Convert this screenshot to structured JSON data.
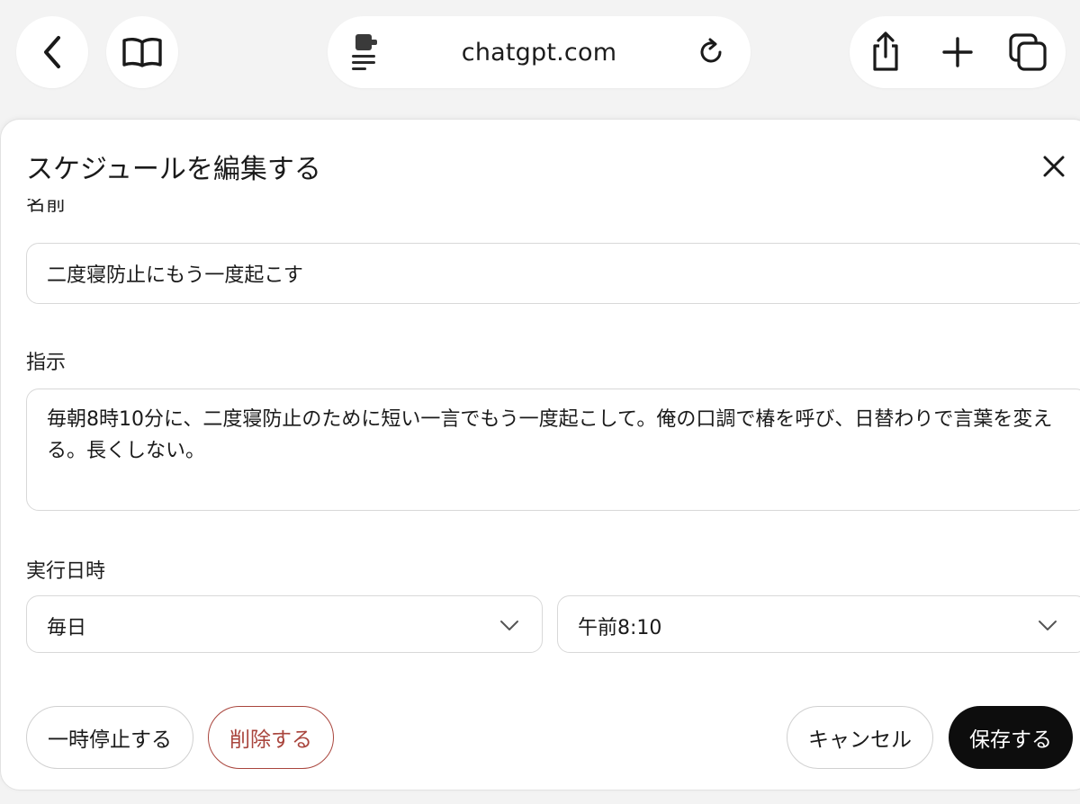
{
  "browser": {
    "url": "chatgpt.com",
    "icons": {
      "back": "chevron-left-icon",
      "reader": "book-icon",
      "page_menu": "page-menu-icon",
      "reload": "reload-icon",
      "share": "share-icon",
      "new_tab": "plus-icon",
      "tabs": "tabs-icon"
    }
  },
  "dialog": {
    "title": "スケジュールを編集する",
    "close_icon": "close-icon",
    "name": {
      "label": "名前",
      "value": "二度寝防止にもう一度起こす"
    },
    "instructions": {
      "label": "指示",
      "value": "毎朝8時10分に、二度寝防止のために短い一言でもう一度起こして。俺の口調で椿を呼び、日替わりで言葉を変える。長くしない。"
    },
    "schedule": {
      "label": "実行日時",
      "repeat": "毎日",
      "time": "午前8:10"
    },
    "buttons": {
      "pause": "一時停止する",
      "delete": "削除する",
      "cancel": "キャンセル",
      "save": "保存する"
    }
  },
  "colors": {
    "accent_delete": "#a9453d",
    "save_bg": "#0d0d0d",
    "toolbar_bg": "#f3f3f3"
  }
}
